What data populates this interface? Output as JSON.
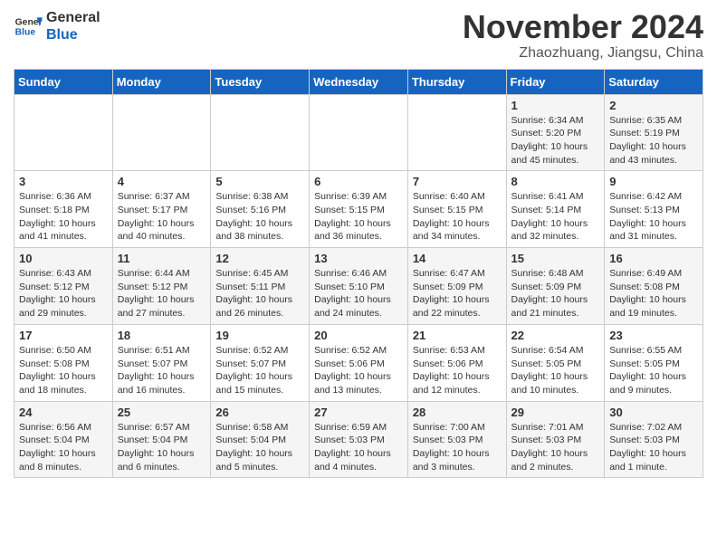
{
  "header": {
    "logo_line1": "General",
    "logo_line2": "Blue",
    "month": "November 2024",
    "location": "Zhaozhuang, Jiangsu, China"
  },
  "weekdays": [
    "Sunday",
    "Monday",
    "Tuesday",
    "Wednesday",
    "Thursday",
    "Friday",
    "Saturday"
  ],
  "weeks": [
    [
      {
        "day": "",
        "info": ""
      },
      {
        "day": "",
        "info": ""
      },
      {
        "day": "",
        "info": ""
      },
      {
        "day": "",
        "info": ""
      },
      {
        "day": "",
        "info": ""
      },
      {
        "day": "1",
        "info": "Sunrise: 6:34 AM\nSunset: 5:20 PM\nDaylight: 10 hours and 45 minutes."
      },
      {
        "day": "2",
        "info": "Sunrise: 6:35 AM\nSunset: 5:19 PM\nDaylight: 10 hours and 43 minutes."
      }
    ],
    [
      {
        "day": "3",
        "info": "Sunrise: 6:36 AM\nSunset: 5:18 PM\nDaylight: 10 hours and 41 minutes."
      },
      {
        "day": "4",
        "info": "Sunrise: 6:37 AM\nSunset: 5:17 PM\nDaylight: 10 hours and 40 minutes."
      },
      {
        "day": "5",
        "info": "Sunrise: 6:38 AM\nSunset: 5:16 PM\nDaylight: 10 hours and 38 minutes."
      },
      {
        "day": "6",
        "info": "Sunrise: 6:39 AM\nSunset: 5:15 PM\nDaylight: 10 hours and 36 minutes."
      },
      {
        "day": "7",
        "info": "Sunrise: 6:40 AM\nSunset: 5:15 PM\nDaylight: 10 hours and 34 minutes."
      },
      {
        "day": "8",
        "info": "Sunrise: 6:41 AM\nSunset: 5:14 PM\nDaylight: 10 hours and 32 minutes."
      },
      {
        "day": "9",
        "info": "Sunrise: 6:42 AM\nSunset: 5:13 PM\nDaylight: 10 hours and 31 minutes."
      }
    ],
    [
      {
        "day": "10",
        "info": "Sunrise: 6:43 AM\nSunset: 5:12 PM\nDaylight: 10 hours and 29 minutes."
      },
      {
        "day": "11",
        "info": "Sunrise: 6:44 AM\nSunset: 5:12 PM\nDaylight: 10 hours and 27 minutes."
      },
      {
        "day": "12",
        "info": "Sunrise: 6:45 AM\nSunset: 5:11 PM\nDaylight: 10 hours and 26 minutes."
      },
      {
        "day": "13",
        "info": "Sunrise: 6:46 AM\nSunset: 5:10 PM\nDaylight: 10 hours and 24 minutes."
      },
      {
        "day": "14",
        "info": "Sunrise: 6:47 AM\nSunset: 5:09 PM\nDaylight: 10 hours and 22 minutes."
      },
      {
        "day": "15",
        "info": "Sunrise: 6:48 AM\nSunset: 5:09 PM\nDaylight: 10 hours and 21 minutes."
      },
      {
        "day": "16",
        "info": "Sunrise: 6:49 AM\nSunset: 5:08 PM\nDaylight: 10 hours and 19 minutes."
      }
    ],
    [
      {
        "day": "17",
        "info": "Sunrise: 6:50 AM\nSunset: 5:08 PM\nDaylight: 10 hours and 18 minutes."
      },
      {
        "day": "18",
        "info": "Sunrise: 6:51 AM\nSunset: 5:07 PM\nDaylight: 10 hours and 16 minutes."
      },
      {
        "day": "19",
        "info": "Sunrise: 6:52 AM\nSunset: 5:07 PM\nDaylight: 10 hours and 15 minutes."
      },
      {
        "day": "20",
        "info": "Sunrise: 6:52 AM\nSunset: 5:06 PM\nDaylight: 10 hours and 13 minutes."
      },
      {
        "day": "21",
        "info": "Sunrise: 6:53 AM\nSunset: 5:06 PM\nDaylight: 10 hours and 12 minutes."
      },
      {
        "day": "22",
        "info": "Sunrise: 6:54 AM\nSunset: 5:05 PM\nDaylight: 10 hours and 10 minutes."
      },
      {
        "day": "23",
        "info": "Sunrise: 6:55 AM\nSunset: 5:05 PM\nDaylight: 10 hours and 9 minutes."
      }
    ],
    [
      {
        "day": "24",
        "info": "Sunrise: 6:56 AM\nSunset: 5:04 PM\nDaylight: 10 hours and 8 minutes."
      },
      {
        "day": "25",
        "info": "Sunrise: 6:57 AM\nSunset: 5:04 PM\nDaylight: 10 hours and 6 minutes."
      },
      {
        "day": "26",
        "info": "Sunrise: 6:58 AM\nSunset: 5:04 PM\nDaylight: 10 hours and 5 minutes."
      },
      {
        "day": "27",
        "info": "Sunrise: 6:59 AM\nSunset: 5:03 PM\nDaylight: 10 hours and 4 minutes."
      },
      {
        "day": "28",
        "info": "Sunrise: 7:00 AM\nSunset: 5:03 PM\nDaylight: 10 hours and 3 minutes."
      },
      {
        "day": "29",
        "info": "Sunrise: 7:01 AM\nSunset: 5:03 PM\nDaylight: 10 hours and 2 minutes."
      },
      {
        "day": "30",
        "info": "Sunrise: 7:02 AM\nSunset: 5:03 PM\nDaylight: 10 hours and 1 minute."
      }
    ]
  ]
}
